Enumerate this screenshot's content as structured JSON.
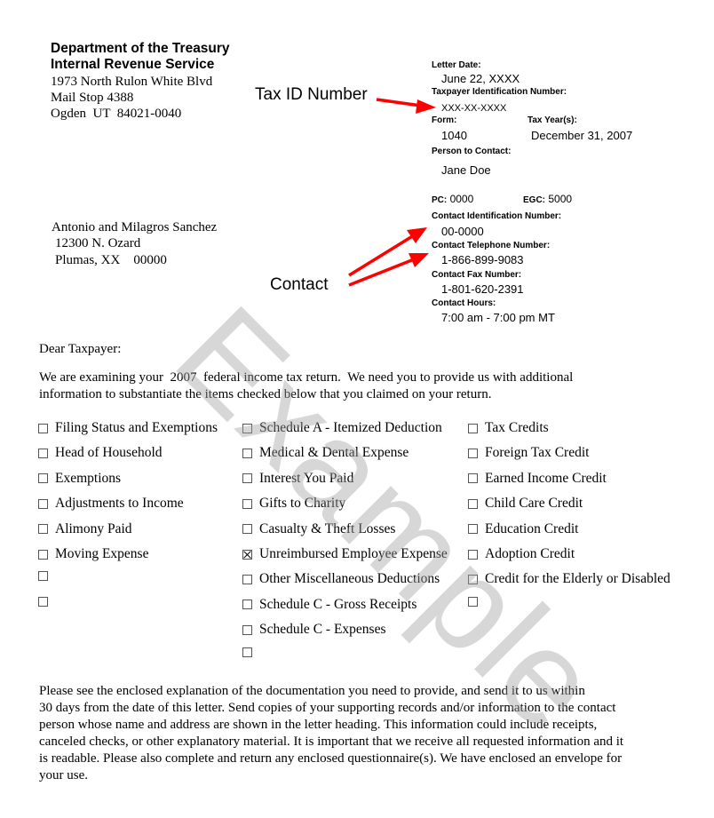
{
  "sender": {
    "line1": "Department of the Treasury",
    "line2": "Internal Revenue Service",
    "street": "1973 North Rulon White Blvd",
    "mailstop": "Mail Stop 4388",
    "city_state_zip": "Ogden  UT  84021-0040"
  },
  "annotations": {
    "tax_id": "Tax ID Number",
    "contact": "Contact",
    "arrow_color": "#ff0000"
  },
  "header_fields": {
    "letter_date_label": "Letter Date:",
    "letter_date": "June 22, XXXX",
    "tin_label": "Taxpayer Identification Number:",
    "tin": "XXX-XX-XXXX",
    "form_label": "Form:",
    "form": "1040",
    "tax_year_label": "Tax Year(s):",
    "tax_year": "December 31, 2007",
    "person_label": "Person to Contact:",
    "person": "Jane Doe",
    "pc_label": "PC:",
    "pc": "0000",
    "egc_label": "EGC:",
    "egc": "5000",
    "contact_id_label": "Contact Identification Number:",
    "contact_id": "00-0000",
    "contact_phone_label": "Contact Telephone Number:",
    "contact_phone": "1-866-899-9083",
    "contact_fax_label": "Contact Fax Number:",
    "contact_fax": "1-801-620-2391",
    "contact_hours_label": "Contact Hours:",
    "contact_hours": "7:00 am - 7:00 pm MT"
  },
  "recipient": {
    "name": "Antonio and Milagros Sanchez",
    "street": "12300 N. Ozard",
    "city_state_zip": "Plumas, XX    00000"
  },
  "salutation": "Dear Taxpayer:",
  "intro": {
    "line1": "We are examining your  2007  federal income tax return.  We need you to provide us with additional",
    "line2": "information to substantiate the items checked below that you claimed on your return."
  },
  "checklist": {
    "col1": [
      {
        "label": "Filing Status and Exemptions",
        "checked": false
      },
      {
        "label": "Head of Household",
        "checked": false
      },
      {
        "label": "Exemptions",
        "checked": false
      },
      {
        "label": "Adjustments to Income",
        "checked": false
      },
      {
        "label": "Alimony Paid",
        "checked": false
      },
      {
        "label": "Moving Expense",
        "checked": false
      },
      {
        "label": "",
        "checked": false
      },
      {
        "label": "",
        "checked": false
      }
    ],
    "col2": [
      {
        "label": "Schedule A - Itemized Deduction",
        "checked": false
      },
      {
        "label": "Medical & Dental Expense",
        "checked": false
      },
      {
        "label": "Interest You Paid",
        "checked": false
      },
      {
        "label": "Gifts to Charity",
        "checked": false
      },
      {
        "label": "Casualty & Theft Losses",
        "checked": false
      },
      {
        "label": "Unreimbursed Employee Expense",
        "checked": true
      },
      {
        "label": "Other Miscellaneous Deductions",
        "checked": false
      },
      {
        "label": "Schedule C - Gross Receipts",
        "checked": false
      },
      {
        "label": "Schedule C - Expenses",
        "checked": false
      },
      {
        "label": "",
        "checked": false
      }
    ],
    "col3": [
      {
        "label": "Tax Credits",
        "checked": false
      },
      {
        "label": "Foreign Tax Credit",
        "checked": false
      },
      {
        "label": "Earned Income Credit",
        "checked": false
      },
      {
        "label": "Child Care Credit",
        "checked": false
      },
      {
        "label": "Education Credit",
        "checked": false
      },
      {
        "label": "Adoption Credit",
        "checked": false
      },
      {
        "label": "Credit for the Elderly or Disabled",
        "checked": false
      },
      {
        "label": "",
        "checked": false
      }
    ]
  },
  "closing": {
    "line1": "Please see the enclosed explanation of the documentation you need to provide, and send it to us within",
    "line2": "30 days from the date of this letter.  Send copies of your supporting records and/or information to the contact",
    "line3": "person whose name and address are shown in the letter heading.  This information could include receipts,",
    "line4": "canceled checks, or other explanatory material.  It is important that we receive all requested information and it",
    "line5": "is readable.  Please also complete and return any enclosed questionnaire(s).  We have enclosed an envelope for",
    "line6": "your use."
  },
  "watermark": "Example"
}
